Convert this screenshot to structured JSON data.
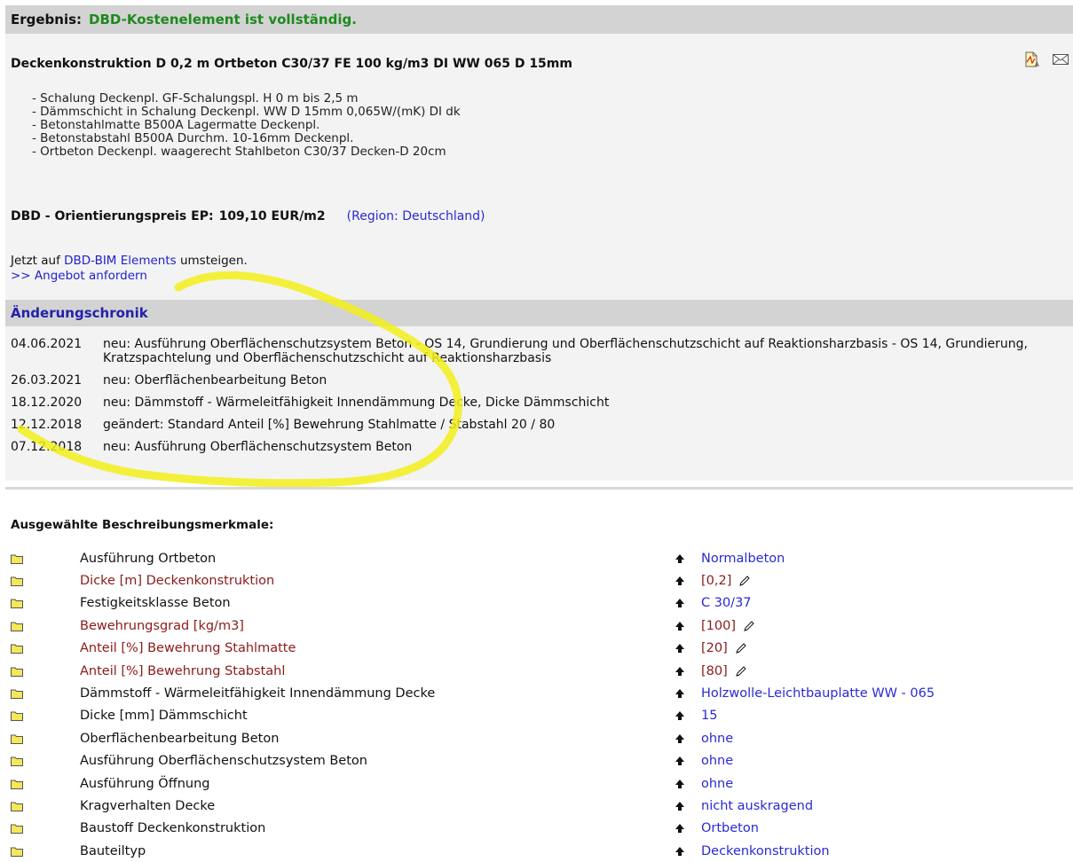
{
  "result": {
    "label": "Ergebnis:",
    "value": "DBD-Kostenelement ist vollständig."
  },
  "element": {
    "title": "Deckenkonstruktion D 0,2 m Ortbeton C30/37 FE 100 kg/m3 DI WW 065 D 15mm",
    "components": [
      "- Schalung Deckenpl. GF-Schalungspl. H 0 m bis 2,5 m",
      "- Dämmschicht in Schalung Deckenpl. WW D 15mm 0,065W/(mK) DI dk",
      "- Betonstahlmatte B500A Lagermatte Deckenpl.",
      "- Betonstabstahl B500A Durchm. 10-16mm Deckenpl.",
      "- Ortbeton Deckenpl. waagerecht Stahlbeton C30/37 Decken-D 20cm"
    ]
  },
  "icons": {
    "pdf": "pdf-document-icon",
    "mail": "mail-envelope-icon"
  },
  "price": {
    "label": "DBD - Orientierungspreis EP:",
    "value": "109,10 EUR/m2",
    "region": "(Region: Deutschland)"
  },
  "bim": {
    "prefix": "Jetzt auf ",
    "link": "DBD-BIM Elements",
    "suffix": " umsteigen."
  },
  "offer": {
    "link": ">> Angebot anfordern"
  },
  "history": {
    "title": "Änderungschronik",
    "items": [
      {
        "date": "04.06.2021",
        "text": "neu: Ausführung Oberflächenschutzsystem Beton - OS 14, Grundierung und Oberflächenschutzschicht auf Reaktionsharzbasis - OS 14, Grundierung, Kratzspachtelung und Oberflächenschutzschicht auf Reaktionsharzbasis"
      },
      {
        "date": "26.03.2021",
        "text": "neu: Oberflächenbearbeitung Beton"
      },
      {
        "date": "18.12.2020",
        "text": "neu: Dämmstoff - Wärmeleitfähigkeit Innendämmung Decke, Dicke Dämmschicht"
      },
      {
        "date": "12.12.2018",
        "text": "geändert: Standard Anteil [%] Bewehrung Stahlmatte / Stabstahl 20 / 80"
      },
      {
        "date": "07.12.2018",
        "text": "neu: Ausführung Oberflächenschutzsystem Beton"
      }
    ]
  },
  "features": {
    "title": "Ausgewählte Beschreibungsmerkmale:",
    "rows": [
      {
        "name": "Ausführung Ortbeton",
        "value": "Normalbeton",
        "edited": false
      },
      {
        "name": "Dicke [m] Deckenkonstruktion",
        "value": "[0,2]",
        "edited": true
      },
      {
        "name": "Festigkeitsklasse Beton",
        "value": "C 30/37",
        "edited": false
      },
      {
        "name": "Bewehrungsgrad [kg/m3]",
        "value": "[100]",
        "edited": true
      },
      {
        "name": "Anteil [%] Bewehrung Stahlmatte",
        "value": "[20]",
        "edited": true
      },
      {
        "name": "Anteil [%] Bewehrung Stabstahl",
        "value": "[80]",
        "edited": true
      },
      {
        "name": "Dämmstoff - Wärmeleitfähigkeit Innendämmung Decke",
        "value": "Holzwolle-Leichtbauplatte WW - 065",
        "edited": false
      },
      {
        "name": "Dicke [mm] Dämmschicht",
        "value": "15",
        "edited": false
      },
      {
        "name": "Oberflächenbearbeitung Beton",
        "value": "ohne",
        "edited": false
      },
      {
        "name": "Ausführung Oberflächenschutzsystem Beton",
        "value": "ohne",
        "edited": false
      },
      {
        "name": "Ausführung Öffnung",
        "value": "ohne",
        "edited": false
      },
      {
        "name": "Kragverhalten Decke",
        "value": "nicht auskragend",
        "edited": false
      },
      {
        "name": "Baustoff Deckenkonstruktion",
        "value": "Ortbeton",
        "edited": false
      },
      {
        "name": "Bauteiltyp",
        "value": "Deckenkonstruktion",
        "edited": false
      }
    ]
  },
  "colors": {
    "result_green": "#1d8a1d",
    "link_blue": "#2a2ad4",
    "edited_red": "#8b1a1a",
    "header_gray": "#d3d3d3",
    "highlight_yellow": "#f2ee1a",
    "folder_yellow": "#f5e65a"
  }
}
